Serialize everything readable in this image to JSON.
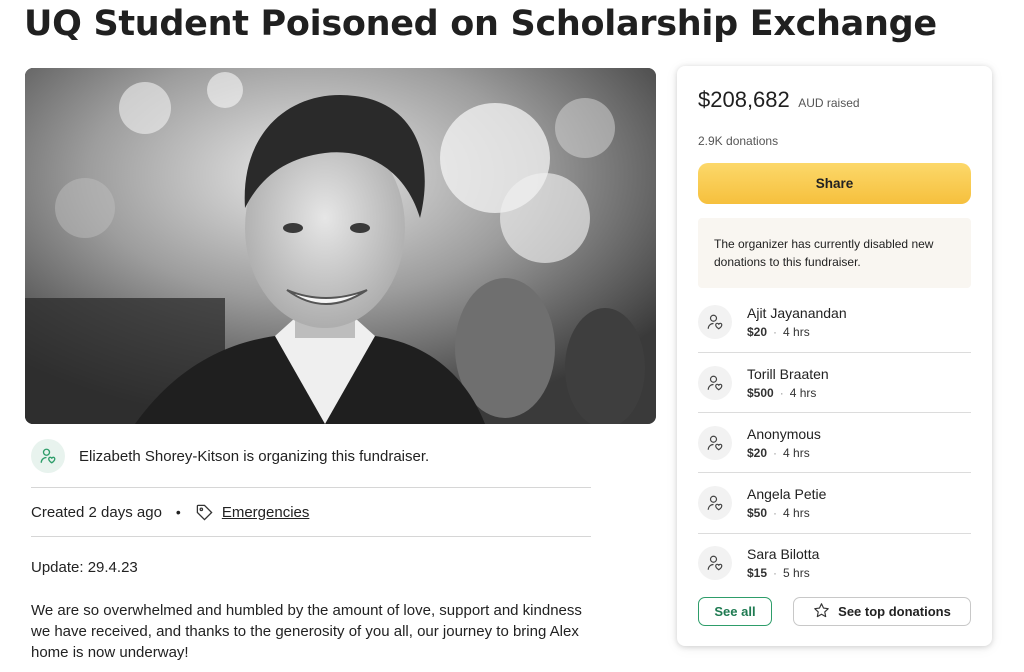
{
  "page": {
    "title": "UQ Student Poisoned on Scholarship Exchange"
  },
  "organizer": {
    "text": "Elizabeth Shorey-Kitson is organizing this fundraiser.",
    "icon": "user-heart-icon"
  },
  "meta": {
    "created": "Created 2 days ago",
    "separator": "•",
    "category": "Emergencies",
    "category_icon": "tag-icon"
  },
  "story": {
    "update_date": "Update: 29.4.23",
    "paragraph": "We are so overwhelmed and humbled by the amount of love, support and kindness we have received, and thanks to the generosity of you all, our journey to bring Alex home is now underway!"
  },
  "card": {
    "amount": "$208,682",
    "amount_unit": "AUD raised",
    "donation_count": "2.9K donations",
    "share_label": "Share",
    "notice": "The organizer has currently disabled new donations to this fundraiser.",
    "donations": [
      {
        "name": "Ajit Jayanandan",
        "amount": "$20",
        "time": "4 hrs"
      },
      {
        "name": "Torill Braaten",
        "amount": "$500",
        "time": "4 hrs"
      },
      {
        "name": "Anonymous",
        "amount": "$20",
        "time": "4 hrs"
      },
      {
        "name": "Angela Petie",
        "amount": "$50",
        "time": "4 hrs"
      },
      {
        "name": "Sara Bilotta",
        "amount": "$15",
        "time": "5 hrs"
      }
    ],
    "meta_separator": "·",
    "see_all_label": "See all",
    "top_donations_label": "See top donations",
    "top_donations_icon": "star-icon"
  },
  "colors": {
    "share_button": "#f6c03d",
    "see_all_border": "#2e9d6a",
    "notice_bg": "#f9f6f1"
  }
}
